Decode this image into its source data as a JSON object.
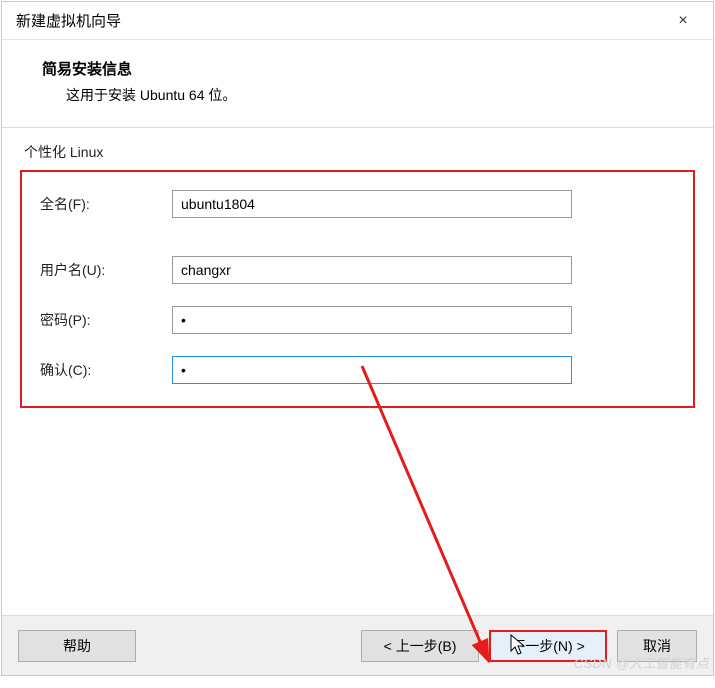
{
  "window": {
    "title": "新建虚拟机向导",
    "close_icon": "×"
  },
  "header": {
    "heading": "简易安装信息",
    "subheading": "这用于安装 Ubuntu 64 位。"
  },
  "group": {
    "label": "个性化 Linux"
  },
  "form": {
    "fullname": {
      "label": "全名(F):",
      "value": "ubuntu1804"
    },
    "username": {
      "label": "用户名(U):",
      "value": "changxr"
    },
    "password": {
      "label": "密码(P):",
      "value": "•"
    },
    "confirm": {
      "label": "确认(C):",
      "value": "•"
    }
  },
  "buttons": {
    "help": "帮助",
    "back": "< 上一步(B)",
    "next": "下一步(N) >",
    "cancel": "取消"
  },
  "watermark": "CSDN @人工智能有点"
}
